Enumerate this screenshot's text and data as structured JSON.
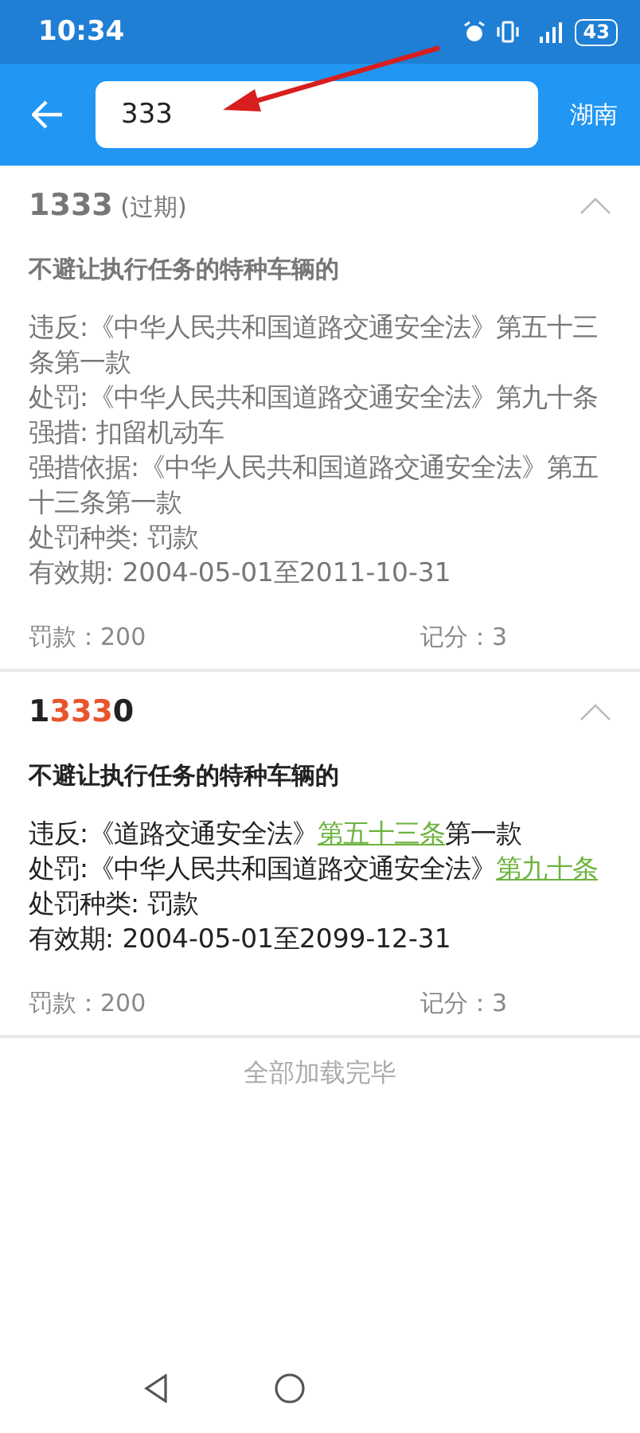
{
  "status_bar": {
    "time": "10:34",
    "battery": "43"
  },
  "header": {
    "search": {
      "value": "333"
    },
    "region": "湖南"
  },
  "results": [
    {
      "expired": true,
      "code": [
        {
          "text": "1333",
          "highlight": false
        }
      ],
      "expired_label": "(过期)",
      "expanded": true,
      "title": "不避让执行任务的特种车辆的",
      "lines": [
        [
          {
            "text": "违反:《中华人民共和国道路交通安全法》第五十三条第一款",
            "link": false
          }
        ],
        [
          {
            "text": "处罚:《中华人民共和国道路交通安全法》第九十条",
            "link": false
          }
        ],
        [
          {
            "text": "强措: 扣留机动车",
            "link": false
          }
        ],
        [
          {
            "text": "强措依据:《中华人民共和国道路交通安全法》第五十三条第一款",
            "link": false
          }
        ],
        [
          {
            "text": "处罚种类: 罚款",
            "link": false
          }
        ],
        [
          {
            "text": "有效期: 2004-05-01至2011-10-31",
            "link": false
          }
        ]
      ],
      "fine": "罚款：200",
      "points": "记分：3"
    },
    {
      "expired": false,
      "code": [
        {
          "text": "1",
          "highlight": false
        },
        {
          "text": "333",
          "highlight": true
        },
        {
          "text": "0",
          "highlight": false
        }
      ],
      "expanded": true,
      "title": "不避让执行任务的特种车辆的",
      "lines": [
        [
          {
            "text": "违反:《道路交通安全法》",
            "link": false
          },
          {
            "text": "第五十三条",
            "link": true
          },
          {
            "text": "第一款",
            "link": false
          }
        ],
        [
          {
            "text": "处罚:《中华人民共和国道路交通安全法》",
            "link": false
          },
          {
            "text": "第九十条",
            "link": true
          }
        ],
        [
          {
            "text": "处罚种类: 罚款",
            "link": false
          }
        ],
        [
          {
            "text": "有效期: 2004-05-01至2099-12-31",
            "link": false
          }
        ]
      ],
      "fine": "罚款：200",
      "points": "记分：3"
    }
  ],
  "end_text": "全部加载完毕"
}
